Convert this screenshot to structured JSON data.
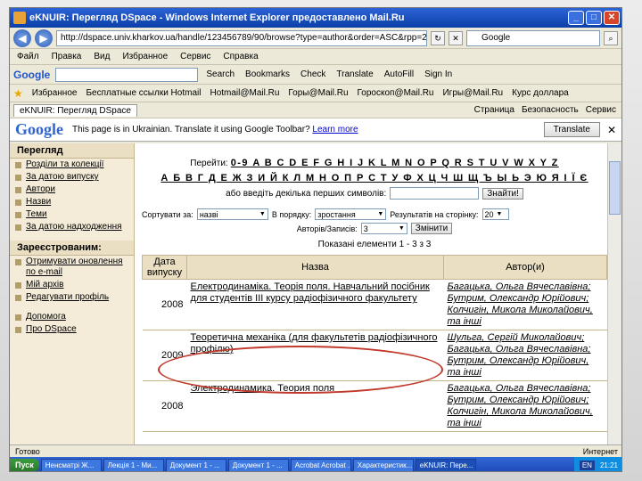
{
  "window": {
    "title": "eKNUIR: Перегляд DSpace - Windows Internet Explorer предоставлено Mail.Ru"
  },
  "address": {
    "url": "http://dspace.univ.kharkov.ua/handle/123456789/90/browse?type=author&order=ASC&rpp=20&value=",
    "search_placeholder": "Google"
  },
  "menu": [
    "Файл",
    "Правка",
    "Вид",
    "Избранное",
    "Сервис",
    "Справка"
  ],
  "google_toolbar": {
    "logo": "Google",
    "items": [
      "Search",
      "Bookmarks",
      "Check",
      "Translate",
      "AutoFill",
      "Sign In"
    ]
  },
  "favorites": {
    "label": "Избранное",
    "items": [
      "Бесплатные ссылки Hotmail",
      "Hotmail@Mail.Ru",
      "Горы@Mail.Ru",
      "Гороскоп@Mail.Ru",
      "Игры@Mail.Ru",
      "Курс доллара"
    ]
  },
  "tab": {
    "label": "eKNUIR: Перегляд DSpace",
    "tools": [
      "Страница",
      "Безопасность",
      "Сервис"
    ]
  },
  "translate_bar": {
    "logo": "Google",
    "text": "This page is in Ukrainian. Translate it using Google Toolbar?",
    "link": "Learn more",
    "button": "Translate",
    "close": "✕"
  },
  "sidebar": {
    "browse_heading": "Перегляд",
    "browse_items": [
      "Розділи та колекції",
      "За датою випуску",
      "Автори",
      "Назви",
      "Теми",
      "За датою надходження"
    ],
    "registered_heading": "Зареєстрованим:",
    "registered_items": [
      "Отримувати оновлення по e-mail",
      "Мій архів",
      "Редагувати профіль",
      "Допомога",
      "Про DSpace"
    ]
  },
  "browse": {
    "goto_label": "Перейти:",
    "latin": "0-9 A B C D E F G H I J K L M N O P Q R S T U V W X Y Z",
    "cyrillic": "А Б В Г Д Е Ж З И Й К Л М Н О П Р С Т У Ф Х Ц Ч Ш Щ Ъ Ы Ь Э Ю Я І Ї Є",
    "enter_label": "або введіть декілька перших символів:",
    "find_button": "Знайти!"
  },
  "sort": {
    "sort_label": "Сортувати за:",
    "sort_value": "назві",
    "order_label": "В порядку:",
    "order_value": "зростання",
    "results_label": "Результатів на сторінку:",
    "results_value": "20",
    "authors_label": "Авторів/Записів:",
    "authors_value": "3",
    "update_button": "Змінити"
  },
  "shown": "Показані елементи 1 - 3 з 3",
  "table": {
    "headers": [
      "Дата випуску",
      "Назва",
      "Автор(и)"
    ],
    "rows": [
      {
        "year": "2008",
        "title": "Електродинаміка. Теорія поля. Навчальний посібник для студентів III курсу радіофізичного факультету",
        "authors": "Багацька, Ольга Вячеславівна; Бутрим, Олександр Юрійович; Колчигін, Микола Миколайович, та інші"
      },
      {
        "year": "2009",
        "title": "Теоретична механіка (для факультетів радіофізичного профілю)",
        "authors": "Шульга, Сергій Миколайович; Багацька, Ольга Вячеславівна; Бутрим, Олександр Юрійович, та інші"
      },
      {
        "year": "2008",
        "title": "Электродинамика. Теория поля",
        "authors": "Багацька, Ольга Вячеславівна; Бутрим, Олександр Юрійович; Колчигін, Микола Миколайович, та інші"
      }
    ]
  },
  "status": {
    "left": "Готово",
    "right": "Интернет"
  },
  "taskbar": {
    "start": "Пуск",
    "tasks": [
      "Ненсматрі Ж...",
      "Лекція 1 - Ми...",
      "Документ 1 - ...",
      "Документ 1 - ...",
      "Acrobat Acrobat ...",
      "Характеристик...",
      "eKNUIR: Пере..."
    ],
    "lang": "EN",
    "clock": "21:21"
  }
}
